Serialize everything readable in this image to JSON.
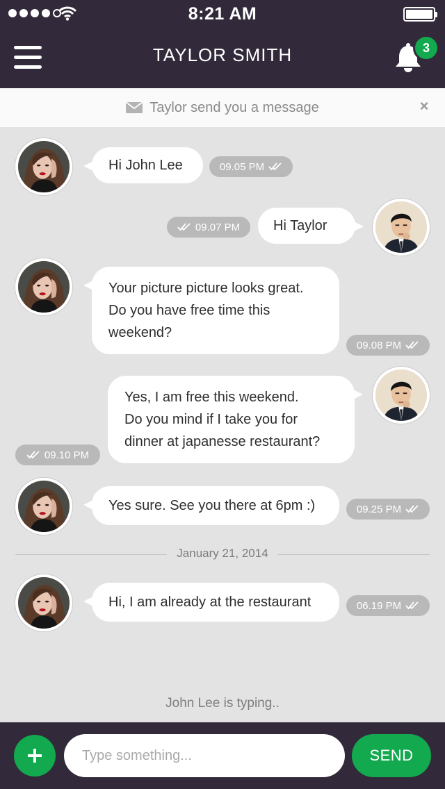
{
  "status_bar": {
    "time": "8:21 AM",
    "signal_bars": 5,
    "signal_filled": 4
  },
  "header": {
    "title": "TAYLOR SMITH",
    "notification_count": "3"
  },
  "notification": {
    "text": "Taylor send you a message"
  },
  "messages": [
    {
      "from": "contact",
      "text": "Hi John Lee",
      "time": "09.05 PM"
    },
    {
      "from": "me",
      "text": "Hi Taylor",
      "time": "09.07 PM"
    },
    {
      "from": "contact",
      "text": "Your picture picture looks great.\nDo you have free time this\nweekend?",
      "time": "09.08 PM"
    },
    {
      "from": "me",
      "text": "Yes, I am free this weekend.\nDo you mind if I take you for\ndinner at japanesse restaurant?",
      "time": "09.10 PM"
    },
    {
      "from": "contact",
      "text": "Yes sure. See you there at 6pm :)",
      "time": "09.25 PM"
    },
    {
      "from": "contact",
      "text": "Hi, I am already at the restaurant",
      "time": "06.19 PM"
    }
  ],
  "date_separator": "January 21, 2014",
  "typing_indicator": "John Lee is typing..",
  "composer": {
    "placeholder": "Type something...",
    "send_label": "SEND"
  },
  "colors": {
    "header_bg": "#322a3a",
    "accent": "#12a94f",
    "chat_bg": "#e3e3e3",
    "stamp_bg": "#b9b9b9"
  }
}
